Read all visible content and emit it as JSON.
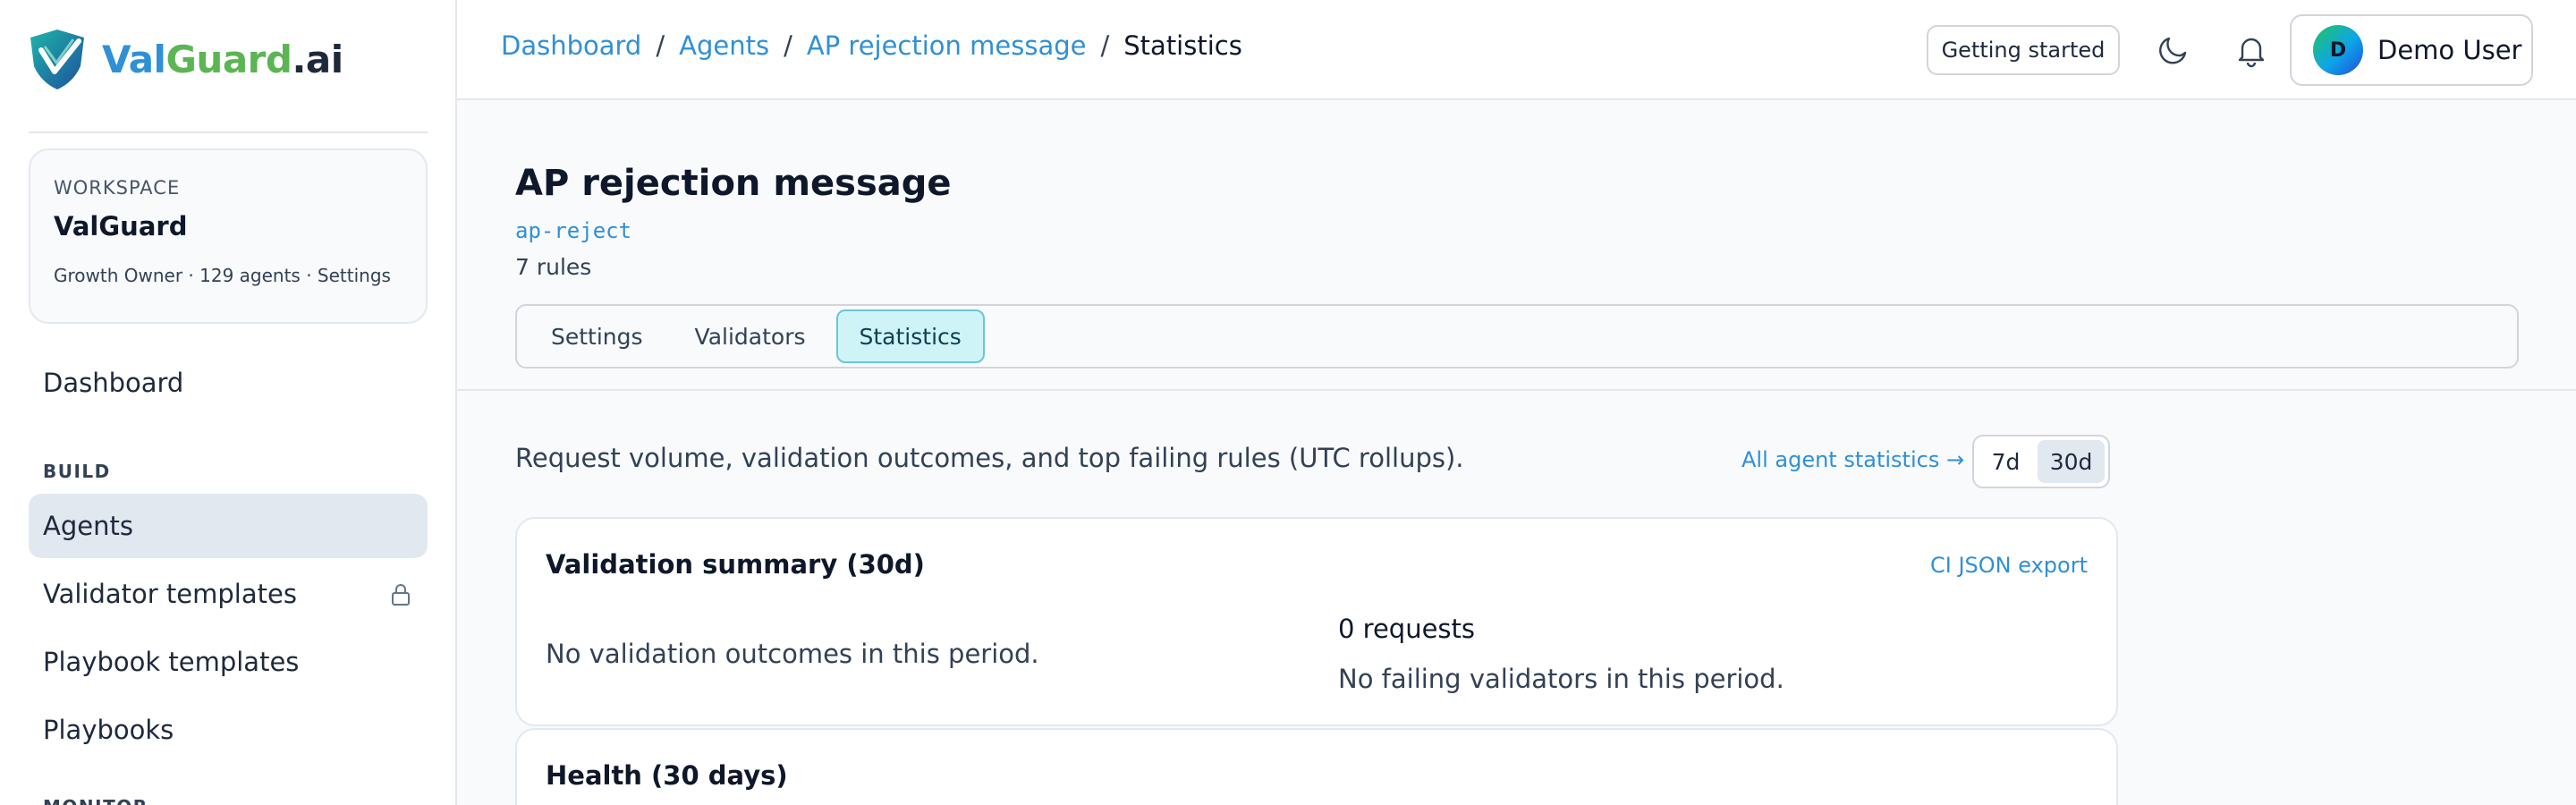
{
  "brand": {
    "name_part1": "Val",
    "name_part2": "Guard",
    "name_part3": ".ai"
  },
  "workspace": {
    "label": "WORKSPACE",
    "name": "ValGuard",
    "meta": "Growth Owner · 129 agents · Settings"
  },
  "sidebar": {
    "items": [
      {
        "label": "Dashboard"
      },
      {
        "label": "Agents",
        "active": true
      },
      {
        "label": "Validator templates",
        "locked": true
      },
      {
        "label": "Playbook templates"
      },
      {
        "label": "Playbooks"
      }
    ],
    "sections": {
      "build": "BUILD",
      "monitor": "MONITOR"
    }
  },
  "breadcrumb": {
    "items": [
      "Dashboard",
      "Agents",
      "AP rejection message"
    ],
    "current": "Statistics",
    "separator": "/"
  },
  "topbar": {
    "getting_started": "Getting started",
    "user": {
      "initial": "D",
      "name": "Demo User"
    }
  },
  "agent": {
    "title": "AP rejection message",
    "slug": "ap-reject",
    "rules": "7 rules",
    "tabs": [
      {
        "label": "Settings"
      },
      {
        "label": "Validators"
      },
      {
        "label": "Statistics",
        "active": true
      }
    ]
  },
  "stats": {
    "description": "Request volume, validation outcomes, and top failing rules (UTC rollups).",
    "all_link": "All agent statistics →",
    "ranges": [
      "7d",
      "30d"
    ],
    "selected_range": "30d",
    "summary": {
      "title": "Validation summary (30d)",
      "export": "CI JSON export",
      "empty": "No validation outcomes in this period.",
      "requests": "0 requests",
      "failing": "No failing validators in this period."
    },
    "health": {
      "title": "Health (30 days)"
    }
  },
  "colors": {
    "accent": "#2f90d6",
    "brand_green": "#5bb553",
    "active_tab_bg": "#cff4f7"
  }
}
